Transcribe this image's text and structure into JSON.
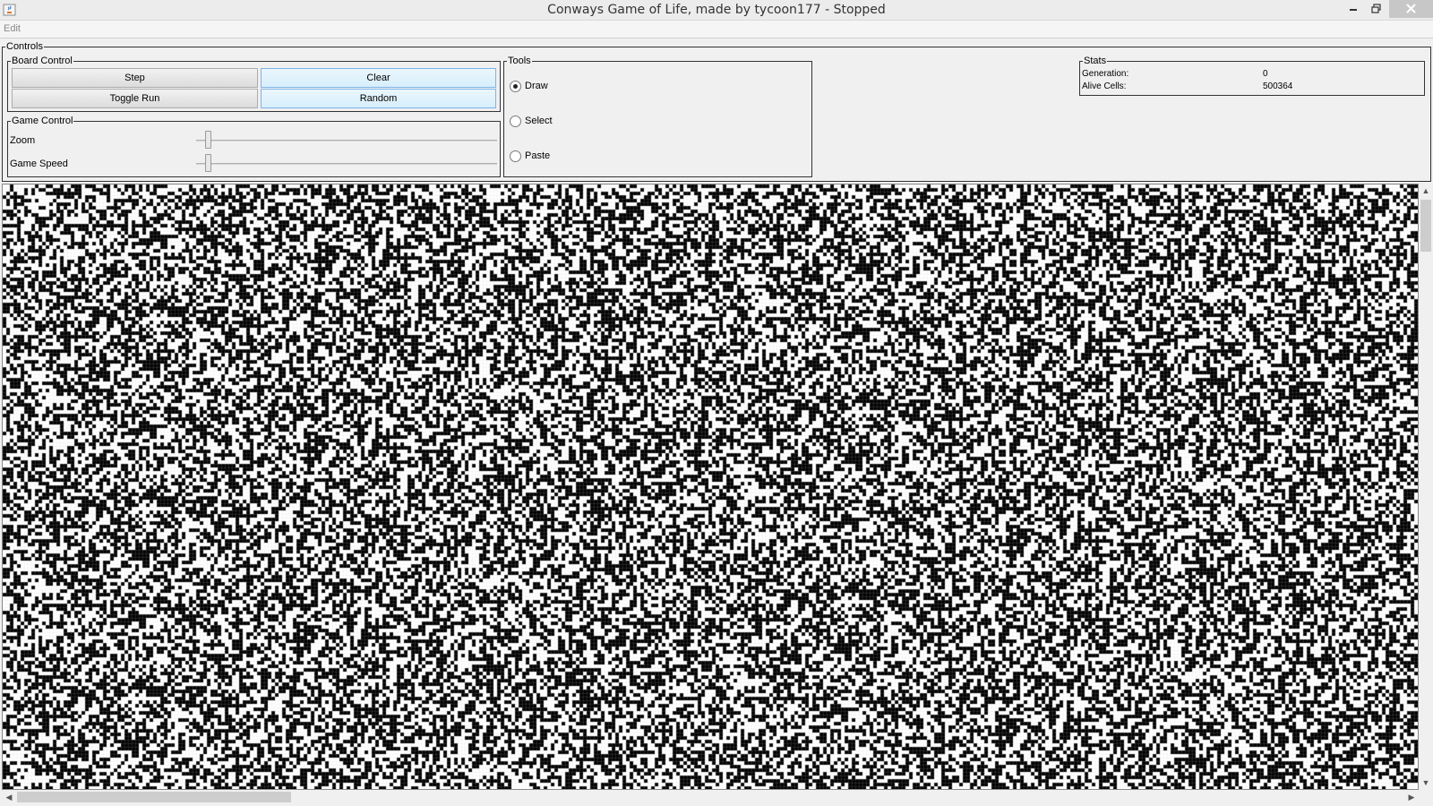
{
  "window": {
    "title": "Conways Game of Life, made by tycoon177 - Stopped",
    "icon": "java-cup-icon"
  },
  "menu": {
    "items": [
      {
        "label": "Edit"
      }
    ]
  },
  "controls": {
    "label": "Controls",
    "board_control": {
      "label": "Board Control",
      "step": "Step",
      "clear": "Clear",
      "toggle_run": "Toggle Run",
      "random": "Random"
    },
    "game_control": {
      "label": "Game Control",
      "zoom": {
        "label": "Zoom",
        "value": 0.04
      },
      "speed": {
        "label": "Game Speed",
        "value": 0.04
      }
    },
    "tools": {
      "label": "Tools",
      "options": [
        {
          "label": "Draw",
          "selected": true
        },
        {
          "label": "Select",
          "selected": false
        },
        {
          "label": "Paste",
          "selected": false
        }
      ]
    },
    "stats": {
      "label": "Stats",
      "generation_label": "Generation:",
      "generation_value": "0",
      "alive_label": "Alive Cells:",
      "alive_value": "500364"
    }
  },
  "board": {
    "alive_color": "#000000",
    "dead_color": "#ffffff",
    "grid_color": "#cfcfcf",
    "vertical_scroll_fraction": 0.0,
    "horizontal_scroll_fraction": 0.0
  }
}
